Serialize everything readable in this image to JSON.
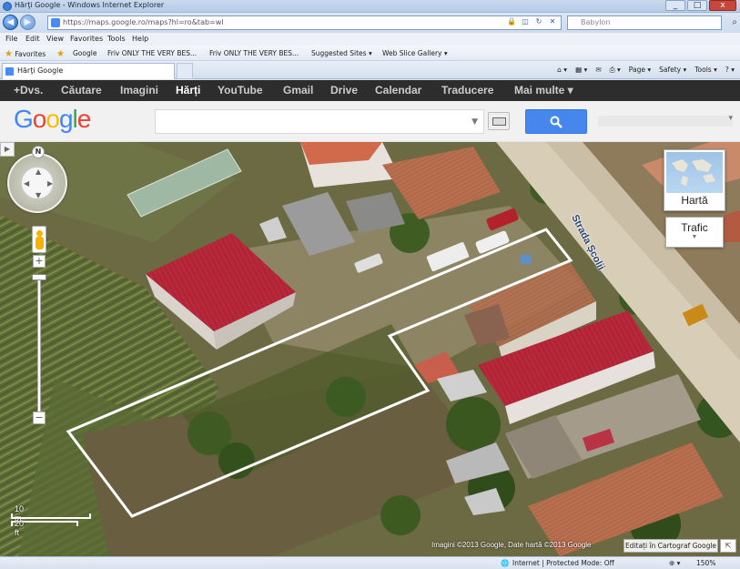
{
  "window": {
    "title": "Hărţi Google - Windows Internet Explorer",
    "controls": [
      "_",
      "□",
      "x"
    ]
  },
  "address_bar": {
    "url": "https://maps.google.ro/maps?hl=ro&tab=wl",
    "search_placeholder": "Babylon"
  },
  "menu": [
    "File",
    "Edit",
    "View",
    "Favorites",
    "Tools",
    "Help"
  ],
  "favorites_bar": {
    "favorites_label": "Favorites",
    "items": [
      "Google",
      "Friv  ONLY THE VERY BES...",
      "Friv  ONLY THE VERY BES...",
      "Suggested Sites ▾",
      "Web Slice Gallery ▾"
    ]
  },
  "tab": {
    "label": "Hărţi Google"
  },
  "command_bar": [
    "Page ▾",
    "Safety ▾",
    "Tools ▾"
  ],
  "google_bar": {
    "items": [
      "+Dvs.",
      "Căutare",
      "Imagini",
      "Hărți",
      "YouTube",
      "Gmail",
      "Drive",
      "Calendar",
      "Traducere",
      "Mai multe ▾"
    ],
    "active": "Hărți"
  },
  "google_logo": "Google",
  "map": {
    "street_label": "Strada Școlii",
    "map_type_label": "Hartă",
    "traffic_label": "Trafic",
    "scale_top": "10 m",
    "scale_bottom": "20 ft",
    "copyright": "Imagini ©2013 Google, Date hartă ©2013 Google",
    "edit_button": "Editați în Cartograf Google",
    "compass_label": "N"
  },
  "status_bar": {
    "zone": "Internet | Protected Mode: Off",
    "zoom": "150%"
  }
}
